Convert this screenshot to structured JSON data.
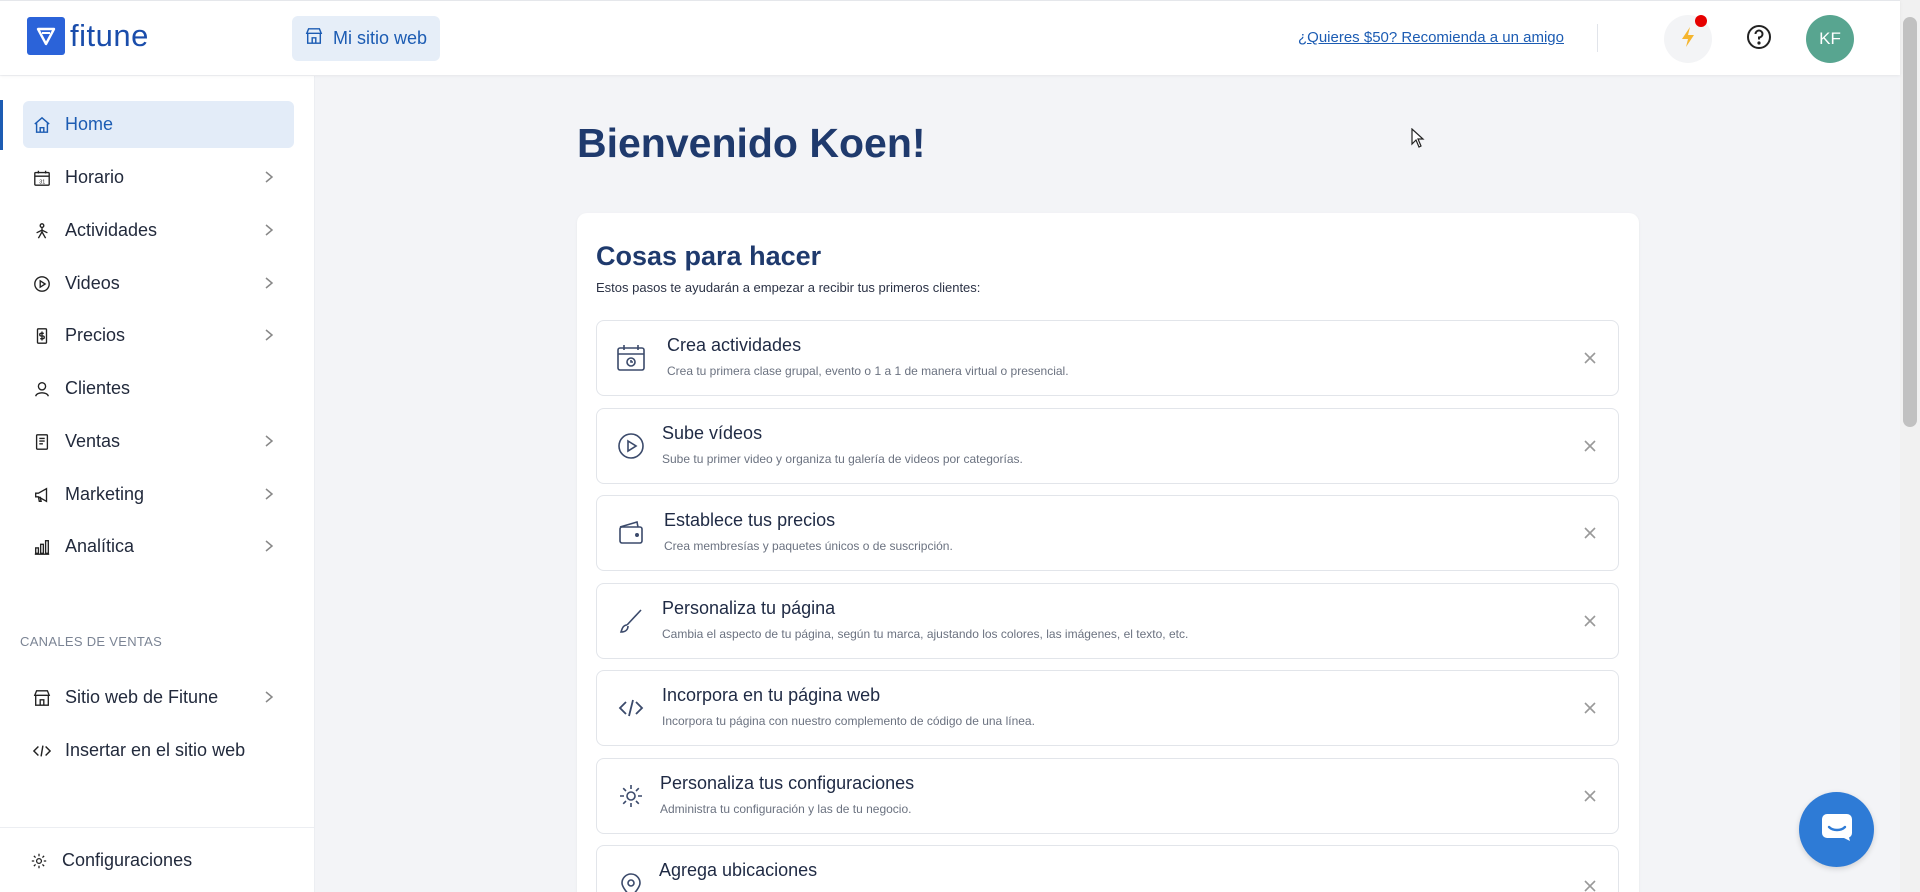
{
  "brand": {
    "name": "fitune"
  },
  "header": {
    "site_button": "Mi sitio web",
    "referral_link": "¿Quieres $50? Recomienda a un amigo",
    "avatar_initials": "KF"
  },
  "sidebar": {
    "items": [
      {
        "label": "Home",
        "icon": "home-icon",
        "active": true
      },
      {
        "label": "Horario",
        "icon": "calendar-icon"
      },
      {
        "label": "Actividades",
        "icon": "activity-icon"
      },
      {
        "label": "Videos",
        "icon": "play-icon"
      },
      {
        "label": "Precios",
        "icon": "price-tag-icon"
      },
      {
        "label": "Clientes",
        "icon": "users-icon"
      },
      {
        "label": "Ventas",
        "icon": "receipt-icon"
      },
      {
        "label": "Marketing",
        "icon": "megaphone-icon"
      },
      {
        "label": "Analítica",
        "icon": "chart-icon"
      }
    ],
    "sales_channels_title": "CANALES DE VENTAS",
    "channels": [
      {
        "label": "Sitio web de Fitune",
        "icon": "store-icon"
      },
      {
        "label": "Insertar en el sitio web",
        "icon": "code-icon"
      }
    ],
    "settings": {
      "label": "Configuraciones",
      "icon": "gear-icon"
    }
  },
  "main": {
    "welcome": "Bienvenido Koen!",
    "todo_title": "Cosas para hacer",
    "todo_subtitle": "Estos pasos te ayudarán a empezar a recibir tus primeros clientes:",
    "tasks": [
      {
        "title": "Crea actividades",
        "desc": "Crea tu primera clase grupal, evento o 1 a 1 de manera virtual o presencial.",
        "icon": "calendar-check-icon"
      },
      {
        "title": "Sube vídeos",
        "desc": "Sube tu primer video y organiza tu galería de videos por categorías.",
        "icon": "play-circle-icon"
      },
      {
        "title": "Establece tus precios",
        "desc": "Crea membresías y paquetes únicos o de suscripción.",
        "icon": "wallet-icon"
      },
      {
        "title": "Personaliza tu página",
        "desc": "Cambia el aspecto de tu página, según tu marca, ajustando los colores, las imágenes, el texto, etc.",
        "icon": "brush-icon"
      },
      {
        "title": "Incorpora en tu página web",
        "desc": "Incorpora tu página con nuestro complemento de código de una línea.",
        "icon": "code-icon"
      },
      {
        "title": "Personaliza tus configuraciones",
        "desc": "Administra tu configuración y las de tu negocio.",
        "icon": "gear-icon"
      },
      {
        "title": "Agrega ubicaciones",
        "desc": "",
        "icon": "location-pin-icon"
      }
    ]
  },
  "colors": {
    "primary": "#1c5cb3",
    "heading": "#1f3a6d",
    "active_bg": "#e3ecf8",
    "avatar": "#58a590",
    "notification": "#e60000",
    "chat": "#2e7bd6"
  }
}
